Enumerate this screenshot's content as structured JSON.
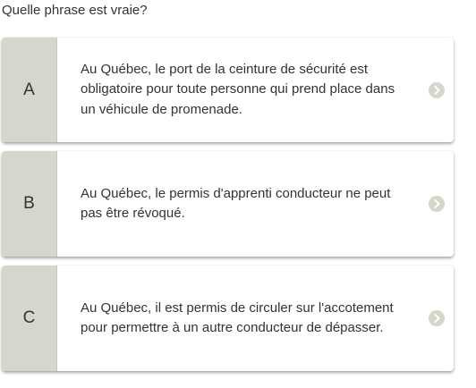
{
  "question": "Quelle phrase est vraie?",
  "options": [
    {
      "letter": "A",
      "text": "Au Québec, le port de la ceinture de sécurité est obligatoire pour toute personne qui prend place dans un véhicule de promenade."
    },
    {
      "letter": "B",
      "text": "Au Québec, le permis d'apprenti conducteur ne peut pas être révoqué."
    },
    {
      "letter": "C",
      "text": "Au Québec, il est permis de circuler sur l'accotement pour permettre à un autre conducteur de dépasser."
    }
  ],
  "colors": {
    "letter_bg": "#d6d7cc",
    "text": "#333333",
    "card_bg": "#ffffff",
    "arrow_bg": "#d6d7cc"
  },
  "icons": {
    "arrow": "chevron-right-circle-icon"
  }
}
